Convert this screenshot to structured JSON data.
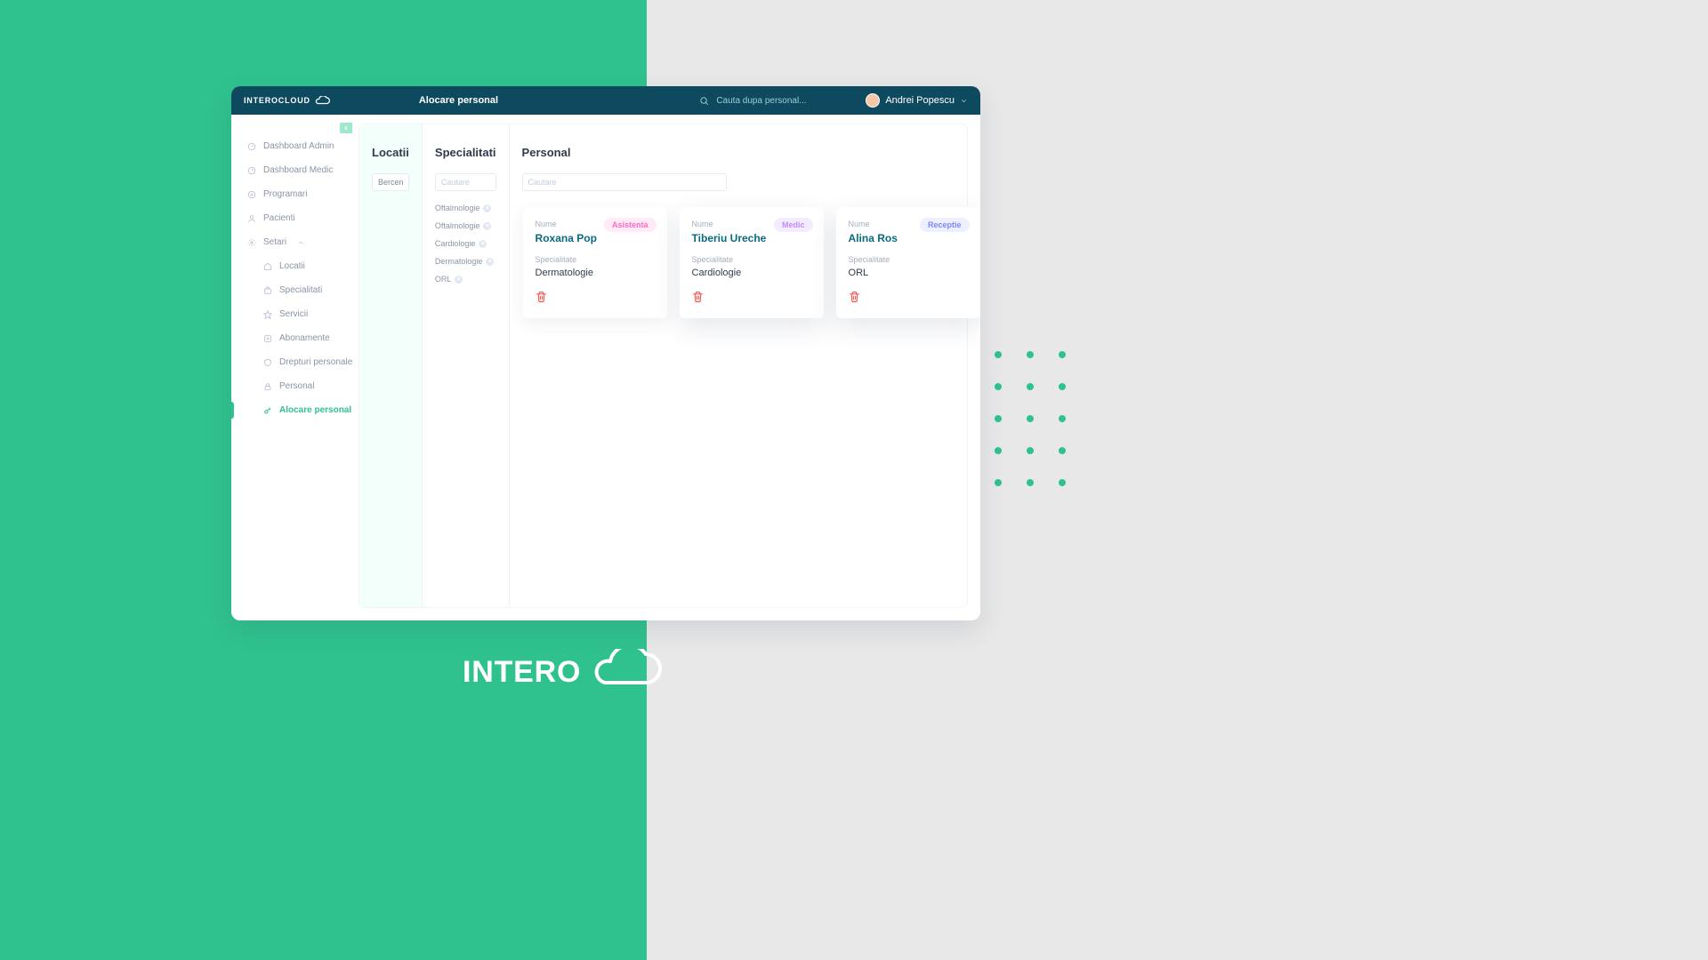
{
  "brand": "INTEROCLOUD",
  "header": {
    "page_title": "Alocare personal",
    "search_placeholder": "Cauta dupa personal...",
    "user_name": "Andrei Popescu"
  },
  "sidebar": {
    "items": [
      {
        "label": "Dashboard Admin"
      },
      {
        "label": "Dashboard Medic"
      },
      {
        "label": "Programari"
      },
      {
        "label": "Pacienti"
      },
      {
        "label": "Setari"
      },
      {
        "label": "Locatii"
      },
      {
        "label": "Specialitati"
      },
      {
        "label": "Servicii"
      },
      {
        "label": "Abonamente"
      },
      {
        "label": "Drepturi personale"
      },
      {
        "label": "Personal"
      },
      {
        "label": "Alocare personal"
      }
    ]
  },
  "columns": {
    "locatii_title": "Locatii",
    "specialitati_title": "Specialitati",
    "personal_title": "Personal",
    "locatii_value": "Berceni",
    "cautare_placeholder": "Cautare",
    "tags": [
      "Oftalmologie",
      "Oftalmologie",
      "Cardiologie",
      "Dermatologie",
      "ORL"
    ]
  },
  "labels": {
    "nume": "Nume",
    "specialitate": "Specialitate"
  },
  "roles": {
    "asistenta": "Asistenta",
    "medic": "Medic",
    "receptie": "Receptie"
  },
  "personal": [
    {
      "name": "Roxana Pop",
      "specialty": "Dermatologie",
      "role": "asistenta"
    },
    {
      "name": "Tiberiu Ureche",
      "specialty": "Cardiologie",
      "role": "medic"
    },
    {
      "name": "Alina Ros",
      "specialty": "ORL",
      "role": "receptie"
    }
  ]
}
